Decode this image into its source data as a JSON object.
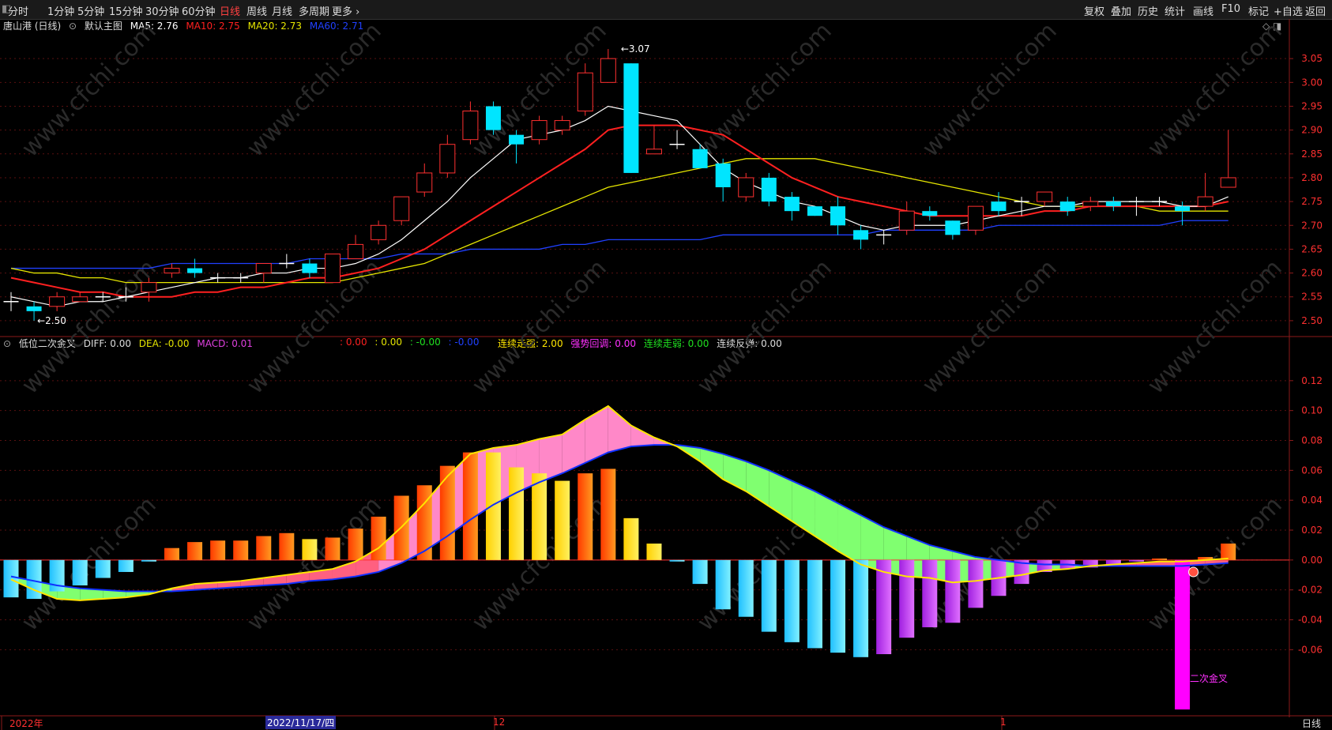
{
  "toolbar": {
    "left_items": [
      "分时",
      "1分钟",
      "5分钟",
      "15分钟",
      "30分钟",
      "60分钟",
      "日线",
      "周线",
      "月线",
      "多周期",
      "更多 ›"
    ],
    "active": "日线",
    "right_items": [
      "复权",
      "叠加",
      "历史",
      "统计",
      "画线",
      "F10",
      "标记",
      "+自选",
      "返回"
    ]
  },
  "main_info": {
    "stock": "唐山港 (日线)",
    "template": "默认主图",
    "ma5": "MA5: 2.76",
    "ma10": "MA10: 2.75",
    "ma20": "MA20: 2.73",
    "ma60": "MA60: 2.71"
  },
  "sub_info": {
    "name": "低位二次金叉",
    "diff": "DIFF: 0.00",
    "dea": "DEA: -0.00",
    "macd": "MACD: 0.01",
    "blank_red": ": 0.00",
    "blank_yellow": ": 0.00",
    "blank_green": ": -0.00",
    "blank_blue": ": -0.00",
    "strong": "连续走强: 2.00",
    "pullback": "强势回调: 0.00",
    "weak": "连续走弱: 0.00",
    "rebound": "连续反弹: 0.00"
  },
  "annotations": {
    "high": "3.07",
    "low": "2.50",
    "golden_cross": "二次金叉"
  },
  "bottom": {
    "year": "2022年",
    "cursor_date": "2022/11/17/四",
    "month_12": "12",
    "month_1": "1",
    "period": "日线"
  },
  "colors": {
    "up": "#ff3030",
    "down": "#00e5ff",
    "ma5": "#ffffff",
    "ma10": "#ff2020",
    "ma20": "#e5e500",
    "ma60": "#2040ff",
    "macd_pos": "#ff5a00",
    "macd_yellow": "#ffe600",
    "macd_neg_cyan": "#40e0ff",
    "macd_neg_purple": "#c040f0",
    "magenta": "#ff00ff"
  },
  "chart_data": {
    "type": "candlestick",
    "ylim": [
      2.47,
      3.1
    ],
    "y_ticks": [
      "3.05",
      "3.00",
      "2.95",
      "2.90",
      "2.85",
      "2.80",
      "2.75",
      "2.70",
      "2.65",
      "2.60",
      "2.55",
      "2.50"
    ],
    "candles": [
      {
        "o": 2.54,
        "c": 2.54,
        "h": 2.56,
        "l": 2.52
      },
      {
        "o": 2.53,
        "c": 2.52,
        "h": 2.54,
        "l": 2.5
      },
      {
        "o": 2.53,
        "c": 2.55,
        "h": 2.56,
        "l": 2.52
      },
      {
        "o": 2.54,
        "c": 2.55,
        "h": 2.56,
        "l": 2.54
      },
      {
        "o": 2.55,
        "c": 2.55,
        "h": 2.56,
        "l": 2.54
      },
      {
        "o": 2.55,
        "c": 2.55,
        "h": 2.57,
        "l": 2.54
      },
      {
        "o": 2.56,
        "c": 2.58,
        "h": 2.59,
        "l": 2.54
      },
      {
        "o": 2.6,
        "c": 2.61,
        "h": 2.62,
        "l": 2.59
      },
      {
        "o": 2.61,
        "c": 2.6,
        "h": 2.63,
        "l": 2.59
      },
      {
        "o": 2.59,
        "c": 2.59,
        "h": 2.6,
        "l": 2.58
      },
      {
        "o": 2.59,
        "c": 2.59,
        "h": 2.6,
        "l": 2.58
      },
      {
        "o": 2.6,
        "c": 2.62,
        "h": 2.62,
        "l": 2.58
      },
      {
        "o": 2.62,
        "c": 2.62,
        "h": 2.64,
        "l": 2.61
      },
      {
        "o": 2.62,
        "c": 2.6,
        "h": 2.63,
        "l": 2.59
      },
      {
        "o": 2.58,
        "c": 2.64,
        "h": 2.64,
        "l": 2.58
      },
      {
        "o": 2.63,
        "c": 2.66,
        "h": 2.68,
        "l": 2.63
      },
      {
        "o": 2.67,
        "c": 2.7,
        "h": 2.71,
        "l": 2.66
      },
      {
        "o": 2.71,
        "c": 2.76,
        "h": 2.76,
        "l": 2.7
      },
      {
        "o": 2.77,
        "c": 2.81,
        "h": 2.83,
        "l": 2.76
      },
      {
        "o": 2.81,
        "c": 2.87,
        "h": 2.89,
        "l": 2.8
      },
      {
        "o": 2.88,
        "c": 2.94,
        "h": 2.96,
        "l": 2.87
      },
      {
        "o": 2.95,
        "c": 2.9,
        "h": 2.96,
        "l": 2.89
      },
      {
        "o": 2.89,
        "c": 2.87,
        "h": 2.9,
        "l": 2.83
      },
      {
        "o": 2.88,
        "c": 2.92,
        "h": 2.93,
        "l": 2.87
      },
      {
        "o": 2.9,
        "c": 2.92,
        "h": 2.93,
        "l": 2.89
      },
      {
        "o": 2.94,
        "c": 3.02,
        "h": 3.04,
        "l": 2.93
      },
      {
        "o": 3.0,
        "c": 3.05,
        "h": 3.07,
        "l": 3.0
      },
      {
        "o": 3.04,
        "c": 2.81,
        "h": 3.04,
        "l": 2.81
      },
      {
        "o": 2.85,
        "c": 2.86,
        "h": 2.91,
        "l": 2.85
      },
      {
        "o": 2.87,
        "c": 2.87,
        "h": 2.9,
        "l": 2.86
      },
      {
        "o": 2.86,
        "c": 2.82,
        "h": 2.87,
        "l": 2.82
      },
      {
        "o": 2.83,
        "c": 2.78,
        "h": 2.84,
        "l": 2.75
      },
      {
        "o": 2.76,
        "c": 2.8,
        "h": 2.81,
        "l": 2.75
      },
      {
        "o": 2.8,
        "c": 2.75,
        "h": 2.81,
        "l": 2.74
      },
      {
        "o": 2.76,
        "c": 2.73,
        "h": 2.77,
        "l": 2.71
      },
      {
        "o": 2.74,
        "c": 2.72,
        "h": 2.74,
        "l": 2.72
      },
      {
        "o": 2.74,
        "c": 2.7,
        "h": 2.76,
        "l": 2.68
      },
      {
        "o": 2.69,
        "c": 2.67,
        "h": 2.7,
        "l": 2.65
      },
      {
        "o": 2.68,
        "c": 2.68,
        "h": 2.69,
        "l": 2.66
      },
      {
        "o": 2.69,
        "c": 2.73,
        "h": 2.75,
        "l": 2.68
      },
      {
        "o": 2.73,
        "c": 2.72,
        "h": 2.74,
        "l": 2.71
      },
      {
        "o": 2.71,
        "c": 2.68,
        "h": 2.71,
        "l": 2.67
      },
      {
        "o": 2.69,
        "c": 2.74,
        "h": 2.74,
        "l": 2.68
      },
      {
        "o": 2.75,
        "c": 2.73,
        "h": 2.77,
        "l": 2.72
      },
      {
        "o": 2.75,
        "c": 2.75,
        "h": 2.76,
        "l": 2.72
      },
      {
        "o": 2.75,
        "c": 2.77,
        "h": 2.77,
        "l": 2.74
      },
      {
        "o": 2.75,
        "c": 2.73,
        "h": 2.76,
        "l": 2.72
      },
      {
        "o": 2.74,
        "c": 2.75,
        "h": 2.76,
        "l": 2.73
      },
      {
        "o": 2.75,
        "c": 2.74,
        "h": 2.76,
        "l": 2.73
      },
      {
        "o": 2.75,
        "c": 2.75,
        "h": 2.76,
        "l": 2.72
      },
      {
        "o": 2.75,
        "c": 2.75,
        "h": 2.76,
        "l": 2.74
      },
      {
        "o": 2.74,
        "c": 2.73,
        "h": 2.75,
        "l": 2.7
      },
      {
        "o": 2.74,
        "c": 2.76,
        "h": 2.81,
        "l": 2.73
      },
      {
        "o": 2.78,
        "c": 2.8,
        "h": 2.9,
        "l": 2.78
      }
    ],
    "ma5": [
      2.55,
      2.54,
      2.53,
      2.54,
      2.54,
      2.55,
      2.56,
      2.57,
      2.58,
      2.59,
      2.59,
      2.6,
      2.6,
      2.61,
      2.61,
      2.62,
      2.64,
      2.67,
      2.71,
      2.75,
      2.8,
      2.84,
      2.88,
      2.89,
      2.9,
      2.92,
      2.95,
      2.94,
      2.93,
      2.92,
      2.87,
      2.82,
      2.79,
      2.77,
      2.75,
      2.74,
      2.72,
      2.7,
      2.69,
      2.7,
      2.7,
      2.7,
      2.71,
      2.72,
      2.73,
      2.74,
      2.74,
      2.75,
      2.75,
      2.75,
      2.75,
      2.74,
      2.74,
      2.76
    ],
    "ma10": [
      2.59,
      2.58,
      2.57,
      2.56,
      2.56,
      2.55,
      2.55,
      2.55,
      2.56,
      2.56,
      2.57,
      2.57,
      2.58,
      2.59,
      2.59,
      2.6,
      2.61,
      2.63,
      2.65,
      2.68,
      2.71,
      2.74,
      2.77,
      2.8,
      2.83,
      2.86,
      2.9,
      2.91,
      2.91,
      2.91,
      2.9,
      2.89,
      2.86,
      2.83,
      2.8,
      2.78,
      2.76,
      2.75,
      2.74,
      2.73,
      2.72,
      2.72,
      2.72,
      2.72,
      2.72,
      2.73,
      2.73,
      2.74,
      2.74,
      2.74,
      2.74,
      2.74,
      2.74,
      2.75
    ],
    "ma20": [
      2.61,
      2.6,
      2.6,
      2.59,
      2.59,
      2.58,
      2.58,
      2.58,
      2.58,
      2.58,
      2.58,
      2.58,
      2.58,
      2.58,
      2.58,
      2.59,
      2.6,
      2.61,
      2.62,
      2.64,
      2.66,
      2.68,
      2.7,
      2.72,
      2.74,
      2.76,
      2.78,
      2.79,
      2.8,
      2.81,
      2.82,
      2.83,
      2.84,
      2.84,
      2.84,
      2.84,
      2.83,
      2.82,
      2.81,
      2.8,
      2.79,
      2.78,
      2.77,
      2.76,
      2.75,
      2.74,
      2.74,
      2.74,
      2.74,
      2.74,
      2.73,
      2.73,
      2.73,
      2.73
    ],
    "ma60": [
      2.61,
      2.61,
      2.61,
      2.61,
      2.61,
      2.61,
      2.61,
      2.62,
      2.62,
      2.62,
      2.62,
      2.62,
      2.62,
      2.63,
      2.63,
      2.63,
      2.63,
      2.64,
      2.64,
      2.64,
      2.65,
      2.65,
      2.65,
      2.65,
      2.66,
      2.66,
      2.67,
      2.67,
      2.67,
      2.67,
      2.67,
      2.68,
      2.68,
      2.68,
      2.68,
      2.68,
      2.68,
      2.68,
      2.69,
      2.69,
      2.69,
      2.69,
      2.69,
      2.7,
      2.7,
      2.7,
      2.7,
      2.7,
      2.7,
      2.7,
      2.7,
      2.71,
      2.71,
      2.71
    ],
    "macd_ylim": [
      -0.1,
      0.14
    ],
    "macd_ticks": [
      "0.12",
      "0.10",
      "0.08",
      "0.06",
      "0.04",
      "0.02",
      "0.00",
      "-0.02",
      "-0.04",
      "-0.06"
    ],
    "diff": [
      -0.013,
      -0.02,
      -0.026,
      -0.027,
      -0.026,
      -0.025,
      -0.023,
      -0.019,
      -0.016,
      -0.015,
      -0.014,
      -0.012,
      -0.01,
      -0.008,
      -0.006,
      -0.001,
      0.008,
      0.022,
      0.038,
      0.056,
      0.071,
      0.075,
      0.077,
      0.081,
      0.084,
      0.094,
      0.103,
      0.09,
      0.082,
      0.076,
      0.066,
      0.054,
      0.046,
      0.036,
      0.026,
      0.016,
      0.006,
      -0.003,
      -0.008,
      -0.011,
      -0.012,
      -0.015,
      -0.014,
      -0.012,
      -0.01,
      -0.007,
      -0.006,
      -0.004,
      -0.003,
      -0.002,
      -0.001,
      -0.001,
      -0.0,
      0.001
    ],
    "dea": [
      -0.011,
      -0.014,
      -0.017,
      -0.019,
      -0.02,
      -0.021,
      -0.021,
      -0.021,
      -0.02,
      -0.019,
      -0.018,
      -0.017,
      -0.016,
      -0.014,
      -0.013,
      -0.011,
      -0.008,
      -0.002,
      0.006,
      0.016,
      0.027,
      0.037,
      0.045,
      0.052,
      0.058,
      0.065,
      0.072,
      0.076,
      0.077,
      0.077,
      0.075,
      0.071,
      0.066,
      0.06,
      0.053,
      0.046,
      0.038,
      0.03,
      0.022,
      0.016,
      0.01,
      0.006,
      0.002,
      -0.0,
      -0.002,
      -0.003,
      -0.003,
      -0.004,
      -0.004,
      -0.004,
      -0.004,
      -0.004,
      -0.003,
      -0.002
    ],
    "macd": [
      -0.025,
      -0.026,
      -0.021,
      -0.017,
      -0.012,
      -0.008,
      -0.001,
      0.008,
      0.012,
      0.013,
      0.013,
      0.016,
      0.018,
      0.014,
      0.015,
      0.021,
      0.029,
      0.043,
      0.05,
      0.063,
      0.072,
      0.072,
      0.062,
      0.058,
      0.053,
      0.058,
      0.061,
      0.028,
      0.011,
      -0.001,
      -0.016,
      -0.033,
      -0.038,
      -0.048,
      -0.055,
      -0.059,
      -0.062,
      -0.065,
      -0.063,
      -0.052,
      -0.045,
      -0.042,
      -0.032,
      -0.024,
      -0.016,
      -0.008,
      -0.006,
      -0.005,
      -0.003,
      -0.001,
      0.001,
      -0.1,
      0.002,
      0.011
    ],
    "macd_yellow_bars": [
      13,
      21,
      22,
      23,
      24,
      27,
      28
    ]
  }
}
